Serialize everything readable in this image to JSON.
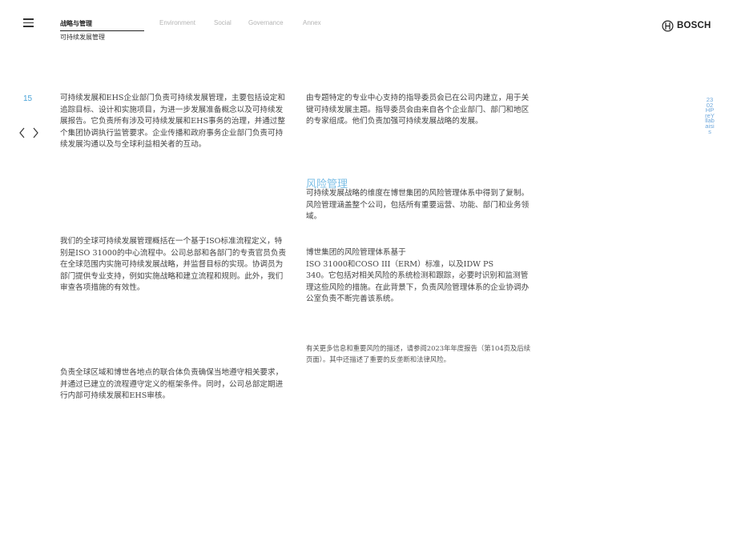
{
  "header": {
    "active_section": "战略与管理",
    "sub_section": "可持续发展管理",
    "tabs": [
      "Environment",
      "Social",
      "Governance",
      "Annex"
    ],
    "brand": "BOSCH"
  },
  "page": {
    "number": "15",
    "side_tag": "2302HPreYllabaisis"
  },
  "content": {
    "left_p1": "可持续发展和EHS企业部门负责可持续发展管理，主要包括设定和追踪目标、设计和实施项目，为进一步发展准备概念以及可持续发展报告。它负责所有涉及可持续发展和EHS事务的治理，并通过整个集团协调执行监管要求。企业传播和政府事务企业部门负责可持续发展沟通以及与全球利益相关者的互动。",
    "left_p2": "我们的全球可持续发展管理概括在一个基于ISO标准流程定义，特别是ISO 31000的中心流程中。公司总部和各部门的专责官员负责在全球范围内实施可持续发展战略，并监督目标的实现。协调员为部门提供专业支持，例如实施战略和建立流程和规则。此外，我们审查各项措施的有效性。",
    "left_p3": "负责全球区域和博世各地点的联合体负责确保当地遵守相关要求，并通过已建立的流程遵守定义的框架条件。同时，公司总部定期进行内部可持续发展和EHS审核。",
    "right_p1": "由专题特定的专业中心支持的指导委员会已在公司内建立，用于关键可持续发展主题。指导委员会由来自各个企业部门、部门和地区的专家组成。他们负责加强可持续发展战略的发展。",
    "risk_heading": "风险管理",
    "right_p2": "可持续发展战略的维度在博世集团的风险管理体系中得到了复制。风险管理涵盖整个公司，包括所有重要运营、功能、部门和业务领域。",
    "right_p3_line1": "博世集团的风险管理体系基于",
    "right_p3_line2": "ISO 31000和COSO III（ERM）标准，以及IDW PS",
    "right_p3_rest": "340。它包括对相关风险的系统检测和跟踪，必要时识别和监测管理这些风险的措施。在此背景下，负责风险管理体系的企业协调办公室负责不断完善该系统。",
    "right_note": "有关更多信息和重要风险的描述，请参阅2023年年度报告（第104页及后续页面）。其中还描述了重要的反垄断和法律风险。"
  },
  "colors": {
    "accent_blue": "#4aa3d8",
    "heading_blue": "#7cbfe6",
    "text": "#444444"
  },
  "icons": [
    "menu-icon",
    "chevron-left-icon",
    "chevron-right-icon",
    "bosch-logo-icon"
  ]
}
